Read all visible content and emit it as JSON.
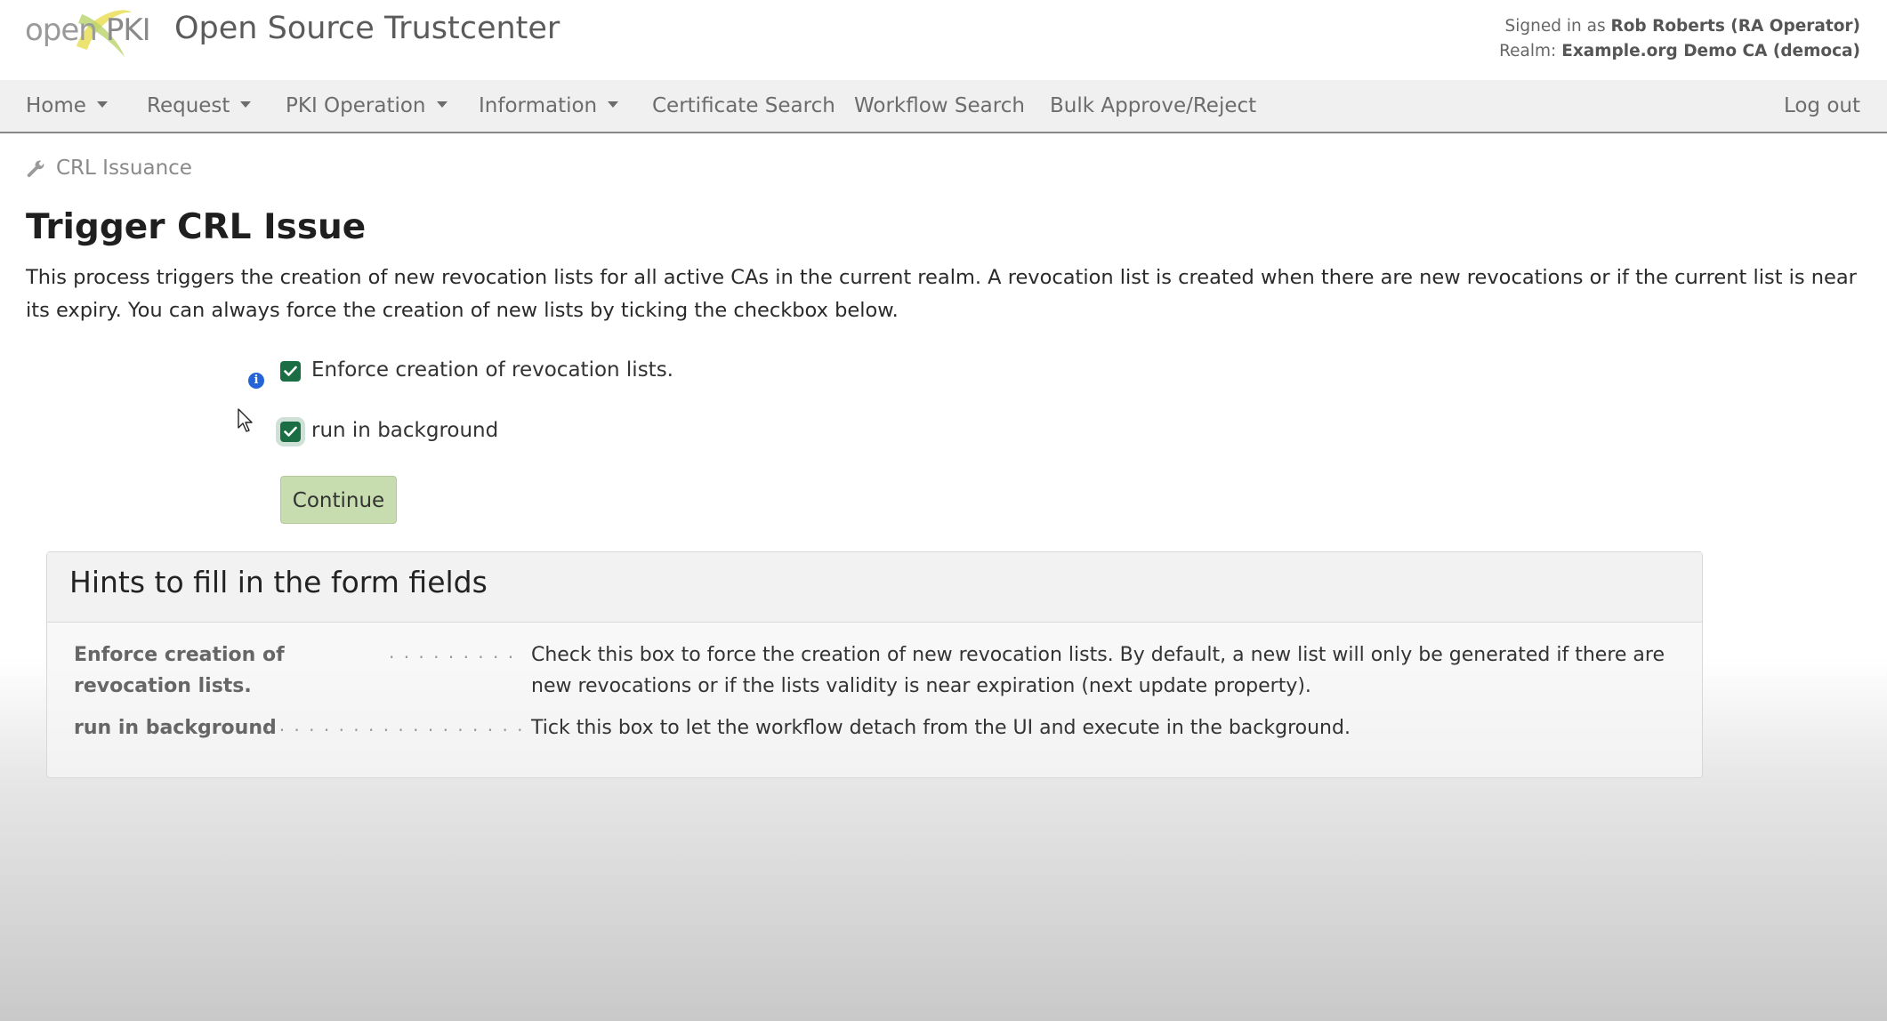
{
  "header": {
    "logo_left": "open",
    "logo_right": "PKI",
    "app_title": "Open Source Trustcenter",
    "signed_in_prefix": "Signed in as",
    "signed_in_user": "Rob Roberts (RA Operator)",
    "realm_prefix": "Realm:",
    "realm_value": "Example.org Demo CA (democa)"
  },
  "nav": {
    "items": [
      "Home",
      "Request",
      "PKI Operation",
      "Information",
      "Certificate Search",
      "Workflow Search",
      "Bulk Approve/Reject"
    ],
    "logout": "Log out"
  },
  "breadcrumb": "CRL Issuance",
  "page": {
    "title": "Trigger CRL Issue",
    "description": "This process triggers the creation of new revocation lists for all active CAs in the current realm. A revocation list is created when there are new revocations or if the current list is near its expiry. You can always force the creation of new lists by ticking the checkbox below."
  },
  "form": {
    "enforce_label": "Enforce creation of revocation lists.",
    "enforce_checked": true,
    "background_label": "run in background",
    "background_checked": true,
    "continue_label": "Continue"
  },
  "hints": {
    "title": "Hints to fill in the form fields",
    "items": [
      {
        "term": "Enforce creation of revocation lists.",
        "definition": "Check this box to force the creation of new revocation lists. By default, a new list will only be generated if there are new revocations or if the lists validity is near expiration (next update property)."
      },
      {
        "term": "run in background",
        "definition": "Tick this box to let the workflow detach from the UI and execute in the background."
      }
    ]
  },
  "colors": {
    "checkbox": "#1b6e44",
    "button": "#c8ddaf",
    "info_icon": "#2563d9"
  }
}
